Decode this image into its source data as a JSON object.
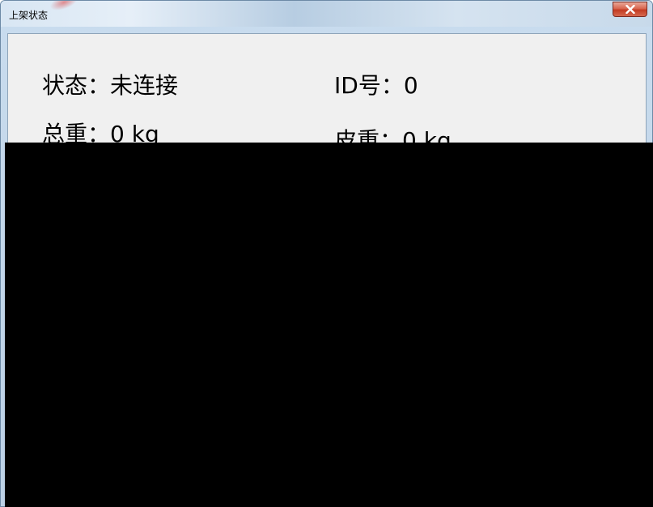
{
  "window": {
    "title": "上架状态"
  },
  "fields": {
    "status": {
      "label": "状态：",
      "value": "未连接"
    },
    "id": {
      "label": "ID号：",
      "value": "0"
    },
    "gross": {
      "label": "总重：",
      "value": "0 kg"
    },
    "tare": {
      "label": "皮重：",
      "value": "0 kg"
    }
  },
  "colors": {
    "client_bg": "#f0f0f0",
    "close_button": "#c33b22",
    "redacted_area": "#000000"
  },
  "icons": {
    "close": "close-icon"
  }
}
